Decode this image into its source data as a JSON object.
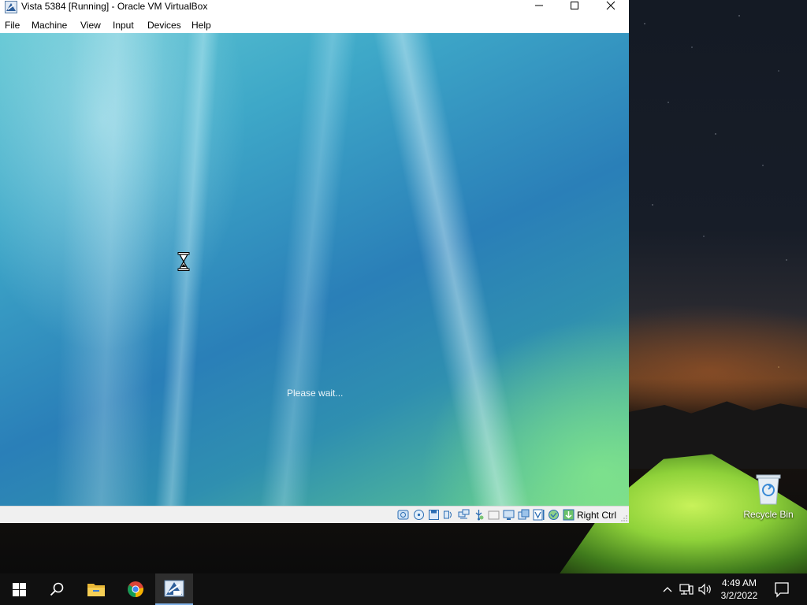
{
  "window": {
    "title": "Vista 5384 [Running] - Oracle VM VirtualBox"
  },
  "menu": [
    "File",
    "Machine",
    "View",
    "Input",
    "Devices",
    "Help"
  ],
  "guest": {
    "status_text": "Please wait..."
  },
  "statusbar": {
    "icons": [
      "hard-disk-icon",
      "optical-drive-icon",
      "floppy-icon",
      "audio-icon",
      "network-icon",
      "usb-icon",
      "shared-folders-icon",
      "display-icon",
      "video-capture-icon",
      "virtualization-icon",
      "cpu-icon",
      "mouse-integration-icon"
    ],
    "host_key": "Right Ctrl"
  },
  "desktop": {
    "recycle_bin_label": "Recycle Bin"
  },
  "taskbar": {
    "apps": [
      "start-icon",
      "search-icon",
      "file-explorer-icon",
      "chrome-icon",
      "virtualbox-icon"
    ],
    "active_app": "virtualbox-icon",
    "time": "4:49 AM",
    "date": "3/2/2022"
  },
  "colors": {
    "taskbar": "#101010",
    "active_indicator": "#7fb0e6",
    "titlebar": "#ffffff"
  }
}
